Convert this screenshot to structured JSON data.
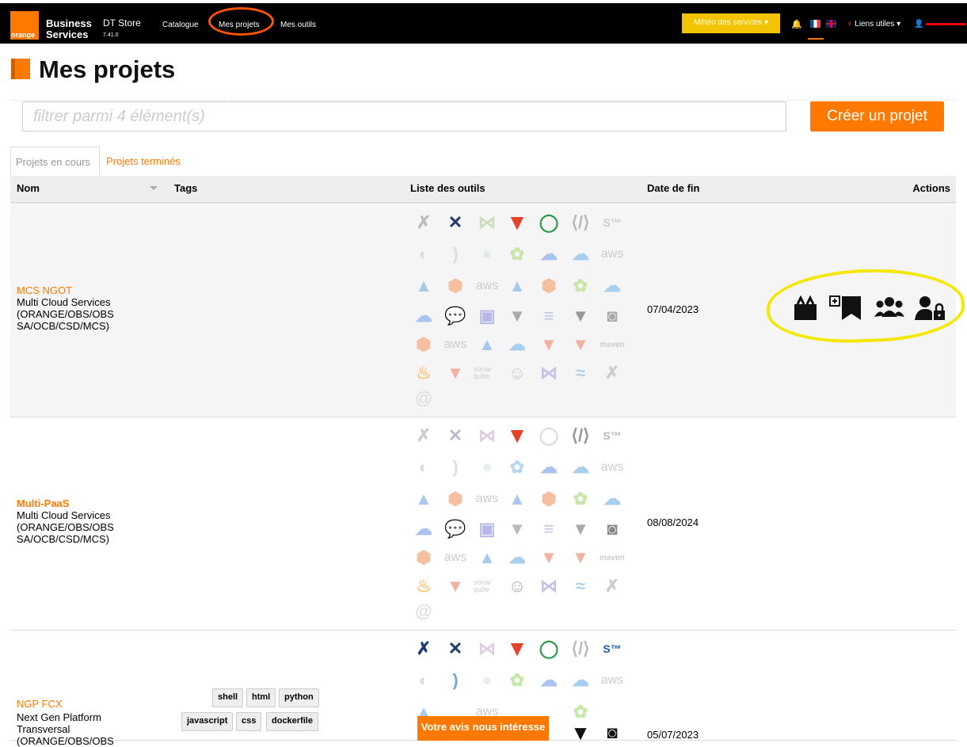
{
  "nav": {
    "logo_text": "orange",
    "brand_line1": "Business",
    "brand_line2": "Services",
    "store": "DT Store",
    "version": "7.41.0",
    "links": [
      "Catalogue",
      "Mes projets",
      "Mes outils"
    ],
    "meteo": "Météo des services ▾",
    "liens": "Liens utiles ▾"
  },
  "page": {
    "title": "Mes projets",
    "filter_placeholder": "filtrer parmi 4 élément(s)",
    "create_button": "Créer un projet"
  },
  "tabs": [
    "Projets en cours",
    "Projets terminés"
  ],
  "table": {
    "headers": [
      "Nom",
      "Tags",
      "Liste des outils",
      "Date de fin",
      "Actions"
    ],
    "rows": [
      {
        "name": "MCS NGOT",
        "desc": "Multi Cloud Services (ORANGE/OBS/OBS SA/OCB/CSD/MCS)",
        "date": "07/04/2023",
        "tags": []
      },
      {
        "name": "Multi-PaaS",
        "desc": "Multi Cloud Services (ORANGE/OBS/OBS SA/OCB/CSD/MCS)",
        "date": "08/08/2024",
        "tags": []
      },
      {
        "name": "NGP FCX",
        "desc": "Next Gen Platform Transversal (ORANGE/OBS/OBS",
        "date": "05/07/2023",
        "tags": [
          "shell",
          "html",
          "python",
          "javascript",
          "css",
          "dockerfile"
        ]
      }
    ]
  },
  "tool_labels": {
    "aws": "aws",
    "sonar": "sonar qube",
    "maven": "maven"
  },
  "feedback": "Votre avis nous intéresse",
  "colors": {
    "accent": "#ff7900",
    "highlight": "#f5e800",
    "meteo": "#f5c400"
  }
}
